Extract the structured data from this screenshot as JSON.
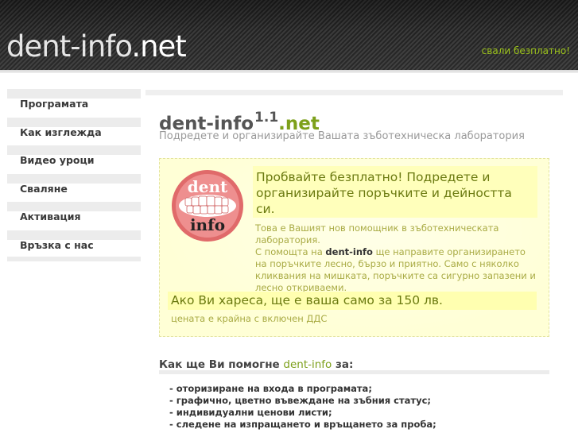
{
  "header": {
    "logo_main": "dent-info",
    "logo_accent": ".net",
    "download_link": "свали безплатно!"
  },
  "sidebar": {
    "items": [
      {
        "label": "Програмата"
      },
      {
        "label": "Как изглежда"
      },
      {
        "label": "Видео уроци"
      },
      {
        "label": "Сваляне"
      },
      {
        "label": "Активация"
      },
      {
        "label": "Връзка с нас"
      }
    ]
  },
  "main": {
    "title": "dent-info",
    "version": "1.1",
    "title_suffix": ".net",
    "subtitle": "Подредете и организирайте Вашата зъботехническа лаборатория"
  },
  "promo": {
    "logo_top": "dent",
    "logo_bottom": "info",
    "headline": "Пробвайте безплатно! Подредете и организирайте поръчките и дейността си.",
    "text_line1": "Това е Вашият нов помощник в зъботехническата лаборатория.",
    "text_line2_prefix": "С помощта на ",
    "text_brand": "dent-info",
    "text_line2_rest": " ще направите организирането на поръчките лесно, бързо и приятно. Само с няколко кликвания на мишката, поръчките са сигурно запазени и лесно откриваеми.",
    "price": "Ако Ви хареса, ще е ваша само за 150 лв.",
    "price_note": "цената е крайна с включен ДДС"
  },
  "help": {
    "heading_prefix": "Как ще Ви помогне ",
    "heading_brand": "dent-info",
    "heading_suffix": " за:",
    "features": [
      "- оторизиране на входа в програмата;",
      "- графично, цветно въвеждане на зъбния статус;",
      "- индивидуални ценови листи;",
      "- следене на изпращането и връщането за проба;"
    ]
  },
  "colors": {
    "accent_green": "#7da01b",
    "header_bg": "#2a2a2a",
    "promo_bg": "#ffffdd"
  }
}
